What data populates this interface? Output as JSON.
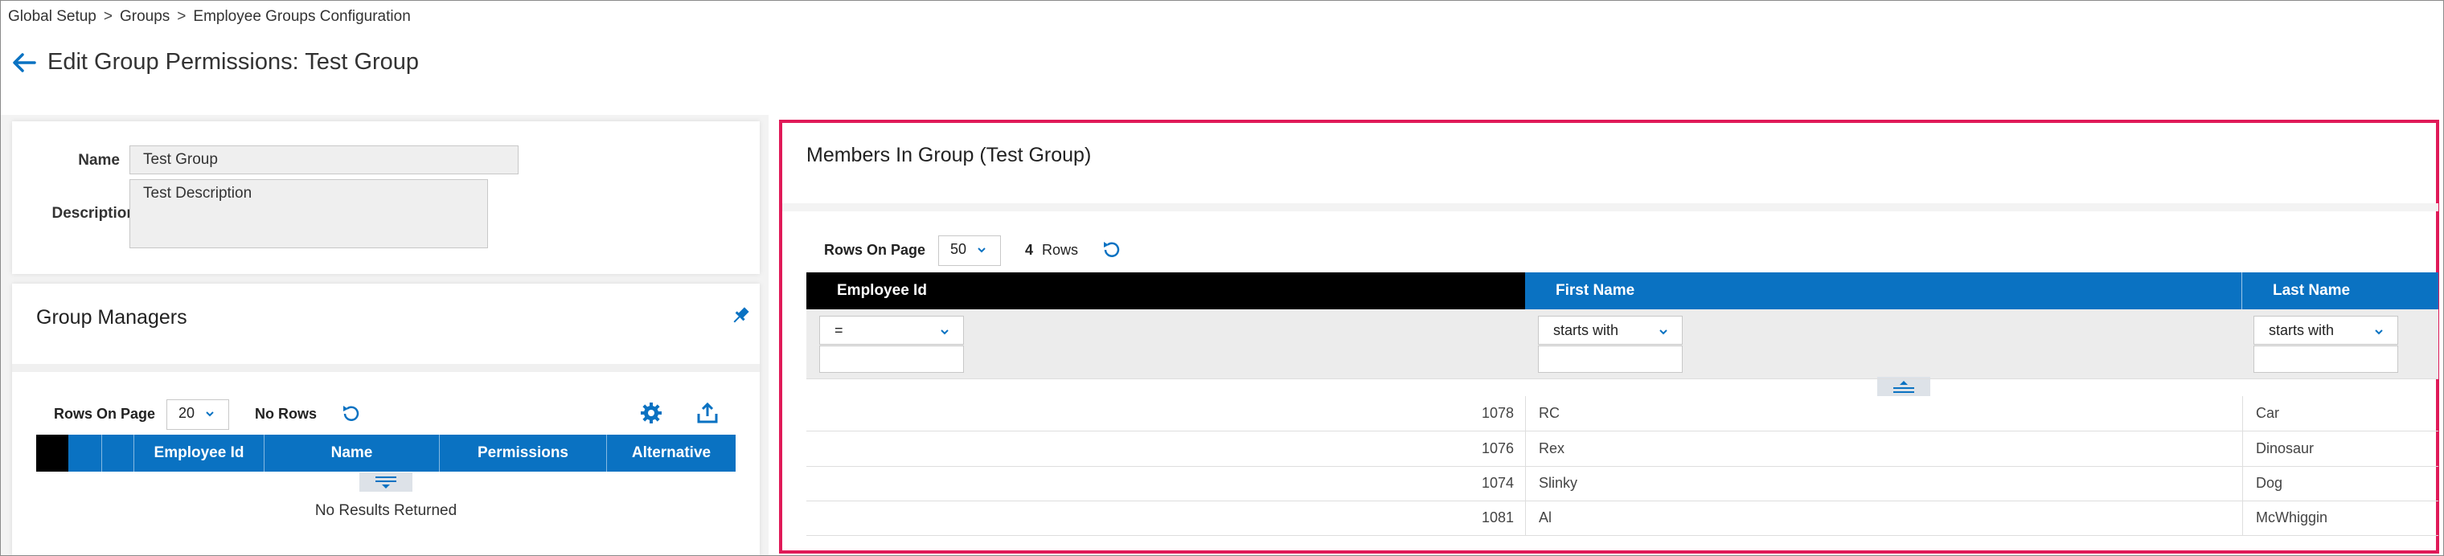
{
  "breadcrumb": {
    "items": [
      "Global Setup",
      "Groups",
      "Employee Groups Configuration"
    ],
    "separator": ">"
  },
  "page": {
    "title": "Edit Group Permissions: Test Group"
  },
  "group_info": {
    "name_label": "Name",
    "name_value": "Test Group",
    "description_label": "Description",
    "description_value": "Test Description"
  },
  "managers": {
    "title": "Group Managers",
    "rows_on_page_label": "Rows On Page",
    "rows_on_page_value": "20",
    "rows_status": "No Rows",
    "columns": [
      "Employee Id",
      "Name",
      "Permissions",
      "Alternative"
    ],
    "empty_message": "No Results Returned"
  },
  "members": {
    "title": "Members In Group (Test Group)",
    "rows_on_page_label": "Rows On Page",
    "rows_on_page_value": "50",
    "row_count": "4",
    "rows_word": "Rows",
    "columns": [
      "Employee Id",
      "First Name",
      "Last Name"
    ],
    "filters": {
      "employee_id_op": "=",
      "first_name_op": "starts with",
      "last_name_op": "starts with"
    },
    "rows": [
      {
        "employee_id": "1078",
        "first_name": "RC",
        "last_name": "Car"
      },
      {
        "employee_id": "1076",
        "first_name": "Rex",
        "last_name": "Dinosaur"
      },
      {
        "employee_id": "1074",
        "first_name": "Slinky",
        "last_name": "Dog"
      },
      {
        "employee_id": "1081",
        "first_name": "Al",
        "last_name": "McWhiggin"
      }
    ]
  },
  "colors": {
    "accent_blue": "#0a72c2",
    "header_black": "#000000",
    "highlight_border": "#e01a58"
  },
  "icons": {
    "back": "arrow-left-icon",
    "pin": "pin-icon",
    "refresh": "refresh-icon",
    "settings": "gear-icon",
    "export": "export-icon",
    "collapse": "collapse-filter-icon",
    "expand": "expand-filter-icon"
  }
}
